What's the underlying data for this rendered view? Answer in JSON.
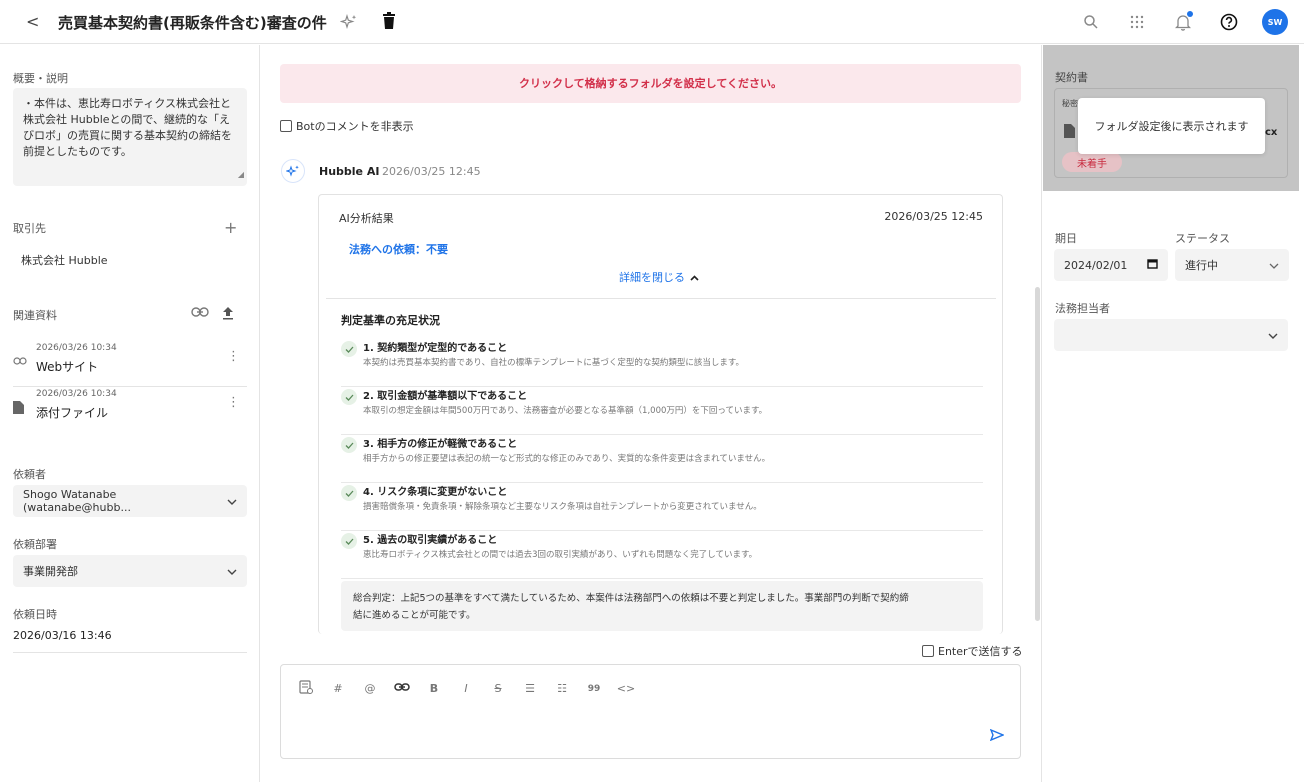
{
  "header": {
    "back": "<",
    "title": "売買基本契約書(再販条件含む)審査の件",
    "avatar": "SW"
  },
  "left": {
    "summary_label": "概要・説明",
    "summary_text": "・本件は、恵比寿ロボティクス株式会社と株式会社 Hubbleとの間で、継続的な「えびロボ」の売買に関する基本契約の締結を前提としたものです。",
    "partner_label": "取引先",
    "partner_value": "株式会社 Hubble",
    "related_label": "関連資料",
    "files": [
      {
        "date": "2026/03/26 10:34",
        "name": "Webサイト",
        "icon": "link-icon"
      },
      {
        "date": "2026/03/26 10:34",
        "name": "添付ファイル",
        "icon": "file-icon"
      }
    ],
    "requester_label": "依頼者",
    "requester_value": "Shogo Watanabe (watanabe@hubb...",
    "dept_label": "依頼部署",
    "dept_value": "事業開発部",
    "req_date_label": "依頼日時",
    "req_date_value": "2026/03/16 13:46"
  },
  "center": {
    "banner": "クリックして格納するフォルダを設定してください。",
    "hide_bot_label": "Botのコメントを非表示",
    "bot_name": "Hubble AI",
    "bot_time": "2026/03/25 12:45",
    "card": {
      "title": "AI分析結果",
      "time": "2026/03/25 12:45",
      "request_result": "法務への依頼：不要",
      "toggle_label": "詳細を閉じる",
      "section_title": "判定基準の充足状況",
      "criteria": [
        {
          "title": "1. 契約類型が定型的であること",
          "desc": "本契約は売買基本契約書であり、自社の標準テンプレートに基づく定型的な契約類型に該当します。"
        },
        {
          "title": "2. 取引金額が基準額以下であること",
          "desc": "本取引の想定金額は年間500万円であり、法務審査が必要となる基準額（1,000万円）を下回っています。"
        },
        {
          "title": "3. 相手方の修正が軽微であること",
          "desc": "相手方からの修正要望は表記の統一など形式的な修正のみであり、実質的な条件変更は含まれていません。"
        },
        {
          "title": "4. リスク条項に変更がないこと",
          "desc": "損害賠償条項・免責条項・解除条項など主要なリスク条項は自社テンプレートから変更されていません。"
        },
        {
          "title": "5. 過去の取引実績があること",
          "desc": "恵比寿ロボティクス株式会社との間では過去3回の取引実績があり、いずれも問題なく完了しています。"
        }
      ],
      "summary_line1": "総合判定：上記5つの基準をすべて満たしているため、本案件は法務部門への依頼は不要と判定しました。事業部門の判断で契約締",
      "summary_line2": "結に進めることが可能です。"
    },
    "enter_send_label": "Enterで送信する",
    "toolbar": [
      "template-icon",
      "hash-icon",
      "mention-icon",
      "link-icon",
      "bold-icon",
      "italic-icon",
      "strike-icon",
      "bullet-list-icon",
      "numbered-list-icon",
      "quote-icon",
      "code-icon"
    ]
  },
  "right": {
    "contract_label": "契約書",
    "contract_sub": "秘密",
    "contract_ext": "cx",
    "status_badge": "未着手",
    "tooltip": "フォルダ設定後に表示されます",
    "due_label": "期日",
    "due_value": "2024/02/01",
    "status_label": "ステータス",
    "status_value": "進行中",
    "legal_label": "法務担当者",
    "legal_value": ""
  },
  "colors": {
    "accent": "#1e73e8",
    "banner_bg": "#fbe8ec",
    "banner_text": "#d2304a",
    "badge_bg": "#e6c2c6",
    "badge_text": "#c82a3e"
  }
}
